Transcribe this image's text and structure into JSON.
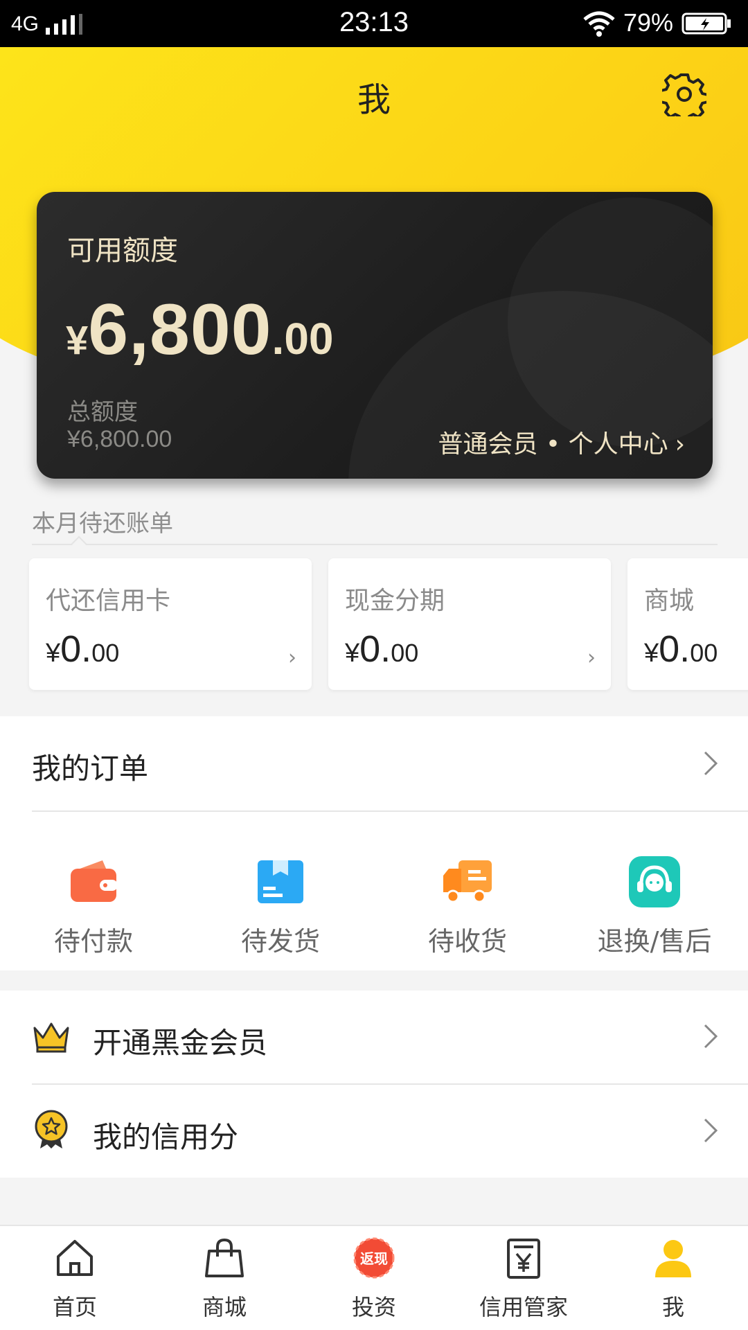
{
  "status_bar": {
    "network": "4G",
    "time": "23:13",
    "battery": "79%"
  },
  "header": {
    "title": "我"
  },
  "card": {
    "label": "可用额度",
    "currency": "¥",
    "amount_int": "6,800",
    "amount_dec": ".00",
    "total_label": "总额度",
    "total_value": "¥6,800.00",
    "member_link": "普通会员 • 个人中心",
    "chevron": "›"
  },
  "bills": {
    "title": "本月待还账单",
    "items": [
      {
        "name": "代还信用卡",
        "currency": "¥",
        "int": "0.",
        "dec": "00"
      },
      {
        "name": "现金分期",
        "currency": "¥",
        "int": "0.",
        "dec": "00"
      },
      {
        "name": "商城",
        "currency": "¥",
        "int": "0.",
        "dec": "00"
      }
    ]
  },
  "orders": {
    "title": "我的订单",
    "statuses": [
      {
        "label": "待付款",
        "icon": "wallet-icon"
      },
      {
        "label": "待发货",
        "icon": "package-icon"
      },
      {
        "label": "待收货",
        "icon": "truck-icon"
      },
      {
        "label": "退换/售后",
        "icon": "headset-icon"
      }
    ]
  },
  "menu": {
    "items": [
      {
        "label": "开通黑金会员",
        "icon": "crown-icon"
      },
      {
        "label": "我的信用分",
        "icon": "medal-icon"
      }
    ]
  },
  "tabbar": {
    "items": [
      {
        "label": "首页",
        "icon": "home-icon"
      },
      {
        "label": "商城",
        "icon": "bag-icon"
      },
      {
        "label": "投资",
        "icon": "cashback-icon",
        "badge": "返现"
      },
      {
        "label": "信用管家",
        "icon": "yen-document-icon"
      },
      {
        "label": "我",
        "icon": "user-icon",
        "active": true
      }
    ]
  },
  "colors": {
    "brand_yellow": "#fcd316",
    "card_dark": "#1f1f1f",
    "card_text": "#efe3c4",
    "wallet": "#f96a44",
    "package": "#2ba9f4",
    "truck": "#ffa13a",
    "headset": "#1ec8b8",
    "crown": "#f6c326",
    "tab_active": "#fcc813"
  }
}
